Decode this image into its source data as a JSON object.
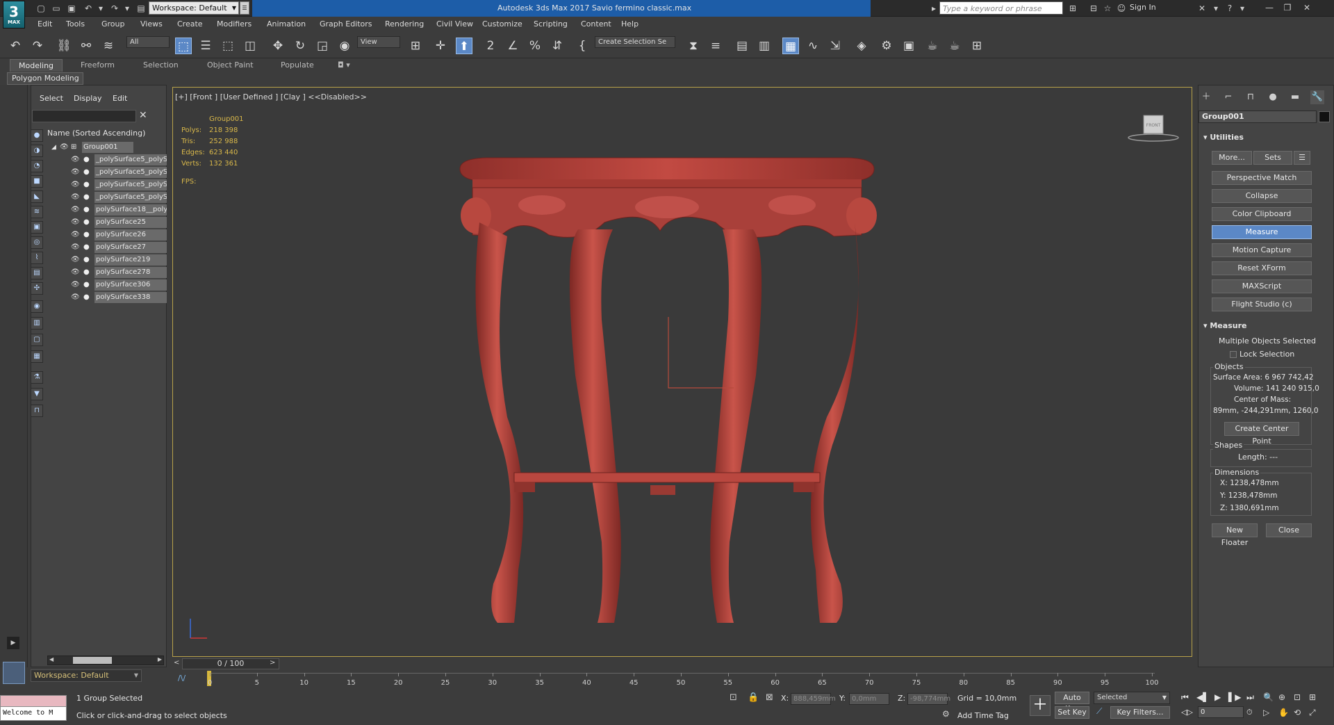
{
  "app": {
    "title": "Autodesk 3ds Max 2017    Savio fermino classic.max",
    "logo_text": "3",
    "logo_subtext": "MAX",
    "workspace": "Workspace: Default",
    "search_placeholder": "Type a keyword or phrase",
    "sign_in": "Sign In"
  },
  "menu": [
    "Edit",
    "Tools",
    "Group",
    "Views",
    "Create",
    "Modifiers",
    "Animation",
    "Graph Editors",
    "Rendering",
    "Civil View",
    "Customize",
    "Scripting",
    "Content",
    "Help"
  ],
  "toolbar": {
    "filter_value": "All",
    "view_value": "View",
    "selection_set_value": "Create Selection Se"
  },
  "ribbon": {
    "tabs": [
      "Modeling",
      "Freeform",
      "Selection",
      "Object Paint",
      "Populate"
    ],
    "active_tab": "Modeling",
    "subpanel": "Polygon Modeling"
  },
  "scene_explorer": {
    "tabs": [
      "Select",
      "Display",
      "Edit"
    ],
    "column_header": "Name (Sorted Ascending)",
    "root": "Group001",
    "items": [
      "_polySurface5_polyS",
      "_polySurface5_polyS",
      "_polySurface5_polyS",
      "_polySurface5_polyS",
      "polySurface18__poly",
      "polySurface25",
      "polySurface26",
      "polySurface27",
      "polySurface219",
      "polySurface278",
      "polySurface306",
      "polySurface338"
    ],
    "workspace_bottom": "Workspace: Default"
  },
  "viewport": {
    "label": "[+] [Front ] [User Defined ] [Clay ]  <<Disabled>>",
    "stats": {
      "object": "Group001",
      "rows": [
        {
          "label": "Polys:",
          "value": "218 398"
        },
        {
          "label": "Tris:",
          "value": "252 988"
        },
        {
          "label": "Edges:",
          "value": "623 440"
        },
        {
          "label": "Verts:",
          "value": "132 361"
        }
      ],
      "fps_label": "FPS:"
    },
    "viewcube_label": "FRONT",
    "model_color": "#b5433b"
  },
  "timeline": {
    "slider_text": "0 / 100",
    "ticks": [
      "0",
      "5",
      "10",
      "15",
      "20",
      "25",
      "30",
      "35",
      "40",
      "45",
      "50",
      "55",
      "60",
      "65",
      "70",
      "75",
      "80",
      "85",
      "90",
      "95",
      "100"
    ]
  },
  "command_panel": {
    "object_name": "Group001",
    "utilities_title": "Utilities",
    "more_label": "More...",
    "sets_label": "Sets",
    "buttons": [
      "Perspective Match",
      "Collapse",
      "Color Clipboard",
      "Measure",
      "Motion Capture",
      "Reset XForm",
      "MAXScript",
      "Flight Studio (c)"
    ],
    "active_button": "Measure",
    "measure": {
      "title": "Measure",
      "status": "Multiple Objects Selected",
      "lock_selection": "Lock Selection",
      "objects_label": "Objects",
      "surface_area": "Surface Area: 6 967 742,42",
      "volume": "Volume:  141 240 915,0",
      "center_of_mass_label": "Center of Mass:",
      "center_of_mass_value": "89mm, -244,291mm, 1260,0",
      "create_center_point": "Create Center Point",
      "shapes_label": "Shapes",
      "length": "Length: ---",
      "dimensions_label": "Dimensions",
      "dim_x": "X:    1238,478mm",
      "dim_y": "Y:    1238,478mm",
      "dim_z": "Z:    1380,691mm",
      "new_floater": "New Floater",
      "close": "Close"
    }
  },
  "status": {
    "maxscript_listener": "Welcome to M",
    "selection_info": "1 Group Selected",
    "prompt": "Click or click-and-drag to select objects",
    "x_label": "X:",
    "x_value": "888,459mm",
    "y_label": "Y:",
    "y_value": "0,0mm",
    "z_label": "Z:",
    "z_value": "-98,774mm",
    "grid": "Grid = 10,0mm",
    "add_time_tag": "Add Time Tag",
    "auto_key": "Auto Key",
    "set_key": "Set Key",
    "selected_value": "Selected",
    "key_filters": "Key Filters...",
    "frame_value": "0"
  }
}
